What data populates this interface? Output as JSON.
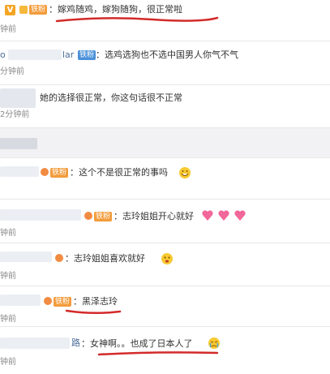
{
  "comments": [
    {
      "prefix": "V",
      "badge": "铁粉",
      "text": "：嫁鸡随鸡，嫁狗随狗，很正常啦",
      "time": "钟前"
    },
    {
      "nick_visible": "lar",
      "badge": "铁粉",
      "text": "：选鸡选狗也不选中国男人你气不气",
      "time": "分钟前",
      "prefix_letter": "o"
    },
    {
      "text": "她的选择很正常，你这句话很不正常",
      "time": "2分钟前"
    },
    {
      "text": "",
      "time": ""
    },
    {
      "badge": "铁粉",
      "text": "：这个不是很正常的事吗",
      "time": ""
    },
    {
      "badge": "铁粉",
      "text": "：志玲姐姐开心就好",
      "time": "钟前"
    },
    {
      "text": "：志玲姐姐喜欢就好",
      "time": "钟前"
    },
    {
      "badge": "铁粉",
      "text": "：黑泽志玲",
      "time": "钟前"
    },
    {
      "nick_visible": "路",
      "text": "：女神啊。。也成了日本人了",
      "time": "钟前"
    }
  ],
  "colors": {
    "red_underline": "#d32a2a",
    "badge_orange": "#f39c3c",
    "badge_blue": "#4a90d9"
  }
}
